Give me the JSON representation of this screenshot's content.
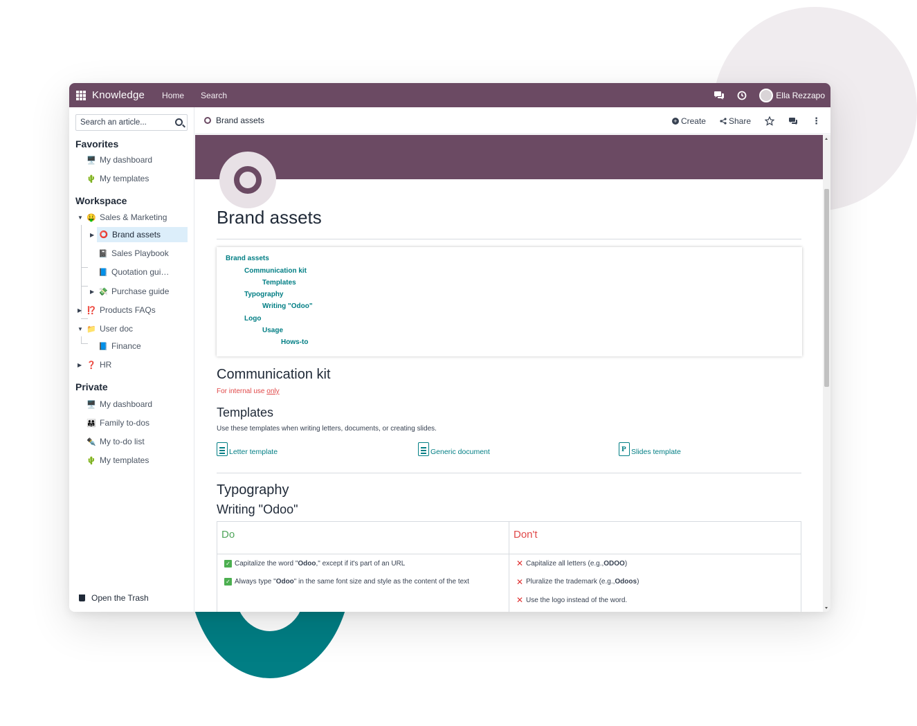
{
  "navbar": {
    "app_name": "Knowledge",
    "links": [
      "Home",
      "Search"
    ],
    "user_name": "Ella Rezzapo"
  },
  "sidebar": {
    "search_placeholder": "Search an article...",
    "favorites_title": "Favorites",
    "favorites": [
      {
        "label": "My dashboard",
        "icon": "🖥️"
      },
      {
        "label": "My templates",
        "icon": "🌵"
      }
    ],
    "workspace_title": "Workspace",
    "workspace": [
      {
        "label": "Sales & Marketing",
        "icon": "🤑"
      },
      {
        "label": "Brand assets",
        "icon": "⭕"
      },
      {
        "label": "Sales Playbook",
        "icon": "📓"
      },
      {
        "label": "Quotation gui…",
        "icon": "📘"
      },
      {
        "label": "Purchase guide",
        "icon": "💸"
      },
      {
        "label": "Products FAQs",
        "icon": "⁉️"
      },
      {
        "label": "User doc",
        "icon": "📁"
      },
      {
        "label": "Finance",
        "icon": "📘"
      },
      {
        "label": "HR",
        "icon": "❓"
      }
    ],
    "private_title": "Private",
    "private": [
      {
        "label": "My dashboard",
        "icon": "🖥️"
      },
      {
        "label": "Family to-dos",
        "icon": "👨‍👩‍👧"
      },
      {
        "label": "My to-do list",
        "icon": "✒️"
      },
      {
        "label": "My templates",
        "icon": "🌵"
      }
    ],
    "trash_label": "Open the Trash"
  },
  "topbar": {
    "breadcrumb": "Brand assets",
    "create_label": "Create",
    "share_label": "Share"
  },
  "article": {
    "title": "Brand assets",
    "toc": [
      {
        "label": "Brand assets",
        "level": 0
      },
      {
        "label": "Communication kit",
        "level": 1
      },
      {
        "label": "Templates",
        "level": 2
      },
      {
        "label": "Typography",
        "level": 1
      },
      {
        "label": "Writing \"Odoo\"",
        "level": 2
      },
      {
        "label": "Logo",
        "level": 1
      },
      {
        "label": "Usage",
        "level": 2
      },
      {
        "label": "Hows-to",
        "level": 3
      }
    ],
    "comm_kit_heading": "Communication kit",
    "internal_note_prefix": "For internal use ",
    "internal_note_emphasis": "only",
    "templates_heading": "Templates",
    "templates_desc": "Use these templates when writing letters, documents, or creating slides.",
    "files": [
      "Letter template",
      "Generic document",
      "Slides template"
    ],
    "typography_heading": "Typography",
    "writing_heading": "Writing \"Odoo\"",
    "do_heading": "Do",
    "dont_heading": "Don't",
    "do_rules": [
      {
        "pre": "Capitalize the word \"",
        "bold": "Odoo",
        "post": ",\" except if it's part of an URL"
      },
      {
        "pre": "Always type \"",
        "bold": "Odoo",
        "post": "\" in the same font size and style as the content of the text"
      }
    ],
    "dont_rules": [
      {
        "pre": "Capitalize all letters (e.g., ",
        "bold": "ODOO",
        "post": ")"
      },
      {
        "pre": "Pluralize the trademark (e.g., ",
        "bold": "Odoos",
        "post": ")"
      },
      {
        "pre": "Use the logo instead of the word.",
        "bold": "",
        "post": ""
      }
    ]
  },
  "colors": {
    "brand": "#6b4a63",
    "link": "#017e84",
    "do": "#4fa55a",
    "dont": "#e04848"
  }
}
